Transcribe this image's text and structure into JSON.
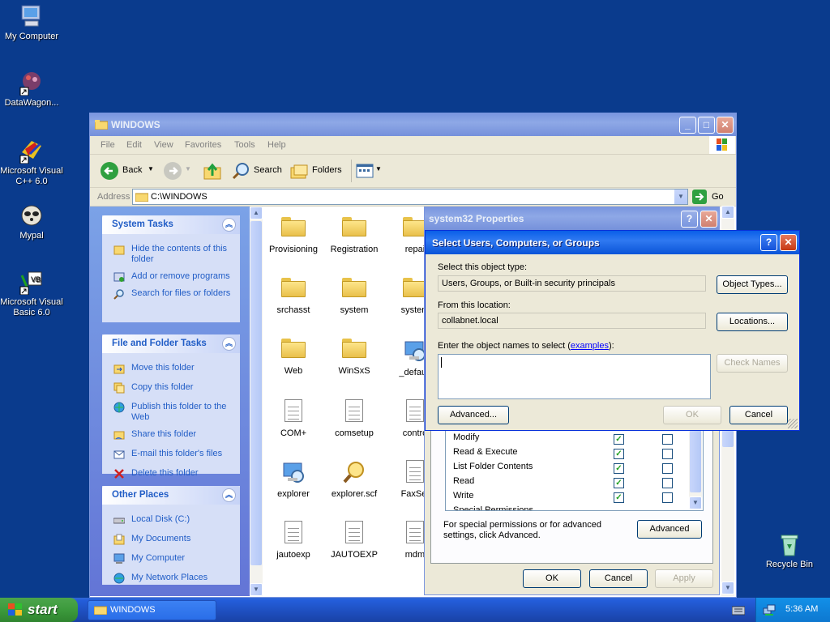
{
  "desktop": {
    "icons": [
      {
        "label": "My Computer"
      },
      {
        "label": "DataWagon..."
      },
      {
        "label": "Microsoft Visual C++ 6.0"
      },
      {
        "label": "Mypal"
      },
      {
        "label": "Microsoft Visual Basic 6.0"
      },
      {
        "label": "Recycle Bin"
      }
    ]
  },
  "explorer": {
    "title": "WINDOWS",
    "menu": [
      "File",
      "Edit",
      "View",
      "Favorites",
      "Tools",
      "Help"
    ],
    "toolbar": {
      "back": "Back",
      "search": "Search",
      "folders": "Folders"
    },
    "address_label": "Address",
    "address_value": "C:\\WINDOWS",
    "go_label": "Go",
    "system_tasks": {
      "title": "System Tasks",
      "items": [
        "Hide the contents of this folder",
        "Add or remove programs",
        "Search for files or folders"
      ]
    },
    "file_tasks": {
      "title": "File and Folder Tasks",
      "items": [
        "Move this folder",
        "Copy this folder",
        "Publish this folder to the Web",
        "Share this folder",
        "E-mail this folder's files",
        "Delete this folder"
      ]
    },
    "other_places": {
      "title": "Other Places",
      "items": [
        "Local Disk (C:)",
        "My Documents",
        "My Computer",
        "My Network Places"
      ]
    },
    "files": [
      {
        "name": "Provisioning",
        "type": "folder"
      },
      {
        "name": "Registration",
        "type": "folder"
      },
      {
        "name": "repai",
        "type": "folder"
      },
      {
        "name": "srchasst",
        "type": "folder"
      },
      {
        "name": "system",
        "type": "folder"
      },
      {
        "name": "system",
        "type": "folder"
      },
      {
        "name": "Web",
        "type": "folder"
      },
      {
        "name": "WinSxS",
        "type": "folder"
      },
      {
        "name": "_default",
        "type": "app"
      },
      {
        "name": "COM+",
        "type": "doc"
      },
      {
        "name": "comsetup",
        "type": "doc"
      },
      {
        "name": "contro",
        "type": "doc"
      },
      {
        "name": "explorer",
        "type": "app"
      },
      {
        "name": "explorer.scf",
        "type": "search"
      },
      {
        "name": "FaxSet",
        "type": "doc"
      },
      {
        "name": "jautoexp",
        "type": "doc"
      },
      {
        "name": "JAUTOEXP",
        "type": "doc"
      },
      {
        "name": "mdm",
        "type": "doc"
      }
    ]
  },
  "properties": {
    "title": "system32 Properties",
    "permissions": [
      {
        "name": "Modify",
        "allow": true,
        "deny": false
      },
      {
        "name": "Read & Execute",
        "allow": true,
        "deny": false
      },
      {
        "name": "List Folder Contents",
        "allow": true,
        "deny": false
      },
      {
        "name": "Read",
        "allow": true,
        "deny": false
      },
      {
        "name": "Write",
        "allow": true,
        "deny": false
      },
      {
        "name": "Special Permissions",
        "allow": false,
        "deny": false
      }
    ],
    "special_note": "For special permissions or for advanced settings, click Advanced.",
    "advanced_label": "Advanced",
    "ok_label": "OK",
    "cancel_label": "Cancel",
    "apply_label": "Apply"
  },
  "select_dialog": {
    "title": "Select Users, Computers, or Groups",
    "object_type_label": "Select this object type:",
    "object_type_value": "Users, Groups, or Built-in security principals",
    "object_types_button": "Object Types...",
    "location_label": "From this location:",
    "location_value": "collabnet.local",
    "locations_button": "Locations...",
    "names_label_prefix": "Enter the object names to select (",
    "names_label_link": "examples",
    "names_label_suffix": "):",
    "names_value": "",
    "check_names_button": "Check Names",
    "advanced_button": "Advanced...",
    "ok_button": "OK",
    "cancel_button": "Cancel"
  },
  "taskbar": {
    "start_label": "start",
    "task_label": "WINDOWS",
    "clock": "5:36 AM"
  }
}
